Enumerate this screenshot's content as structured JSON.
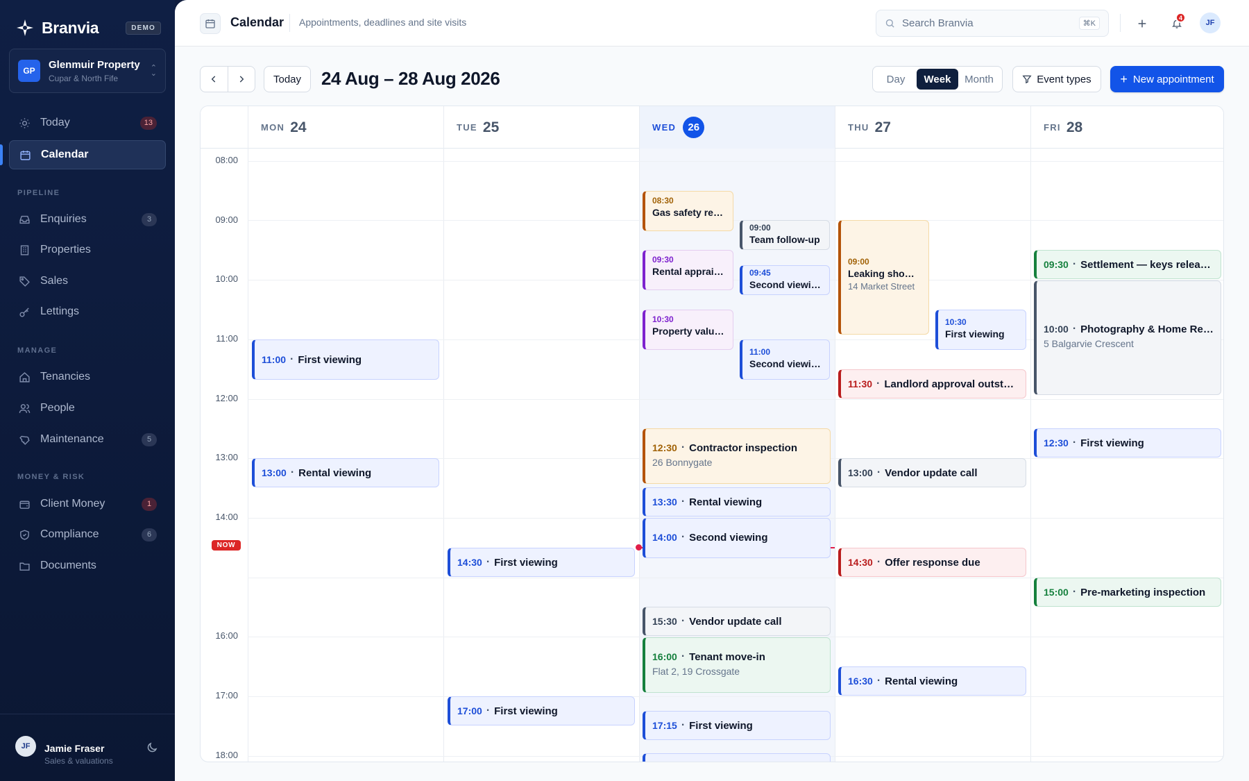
{
  "sidebar": {
    "brand": "Branvia",
    "demo_badge": "DEMO",
    "org": {
      "initials": "GP",
      "name": "Glenmuir Property",
      "subtitle": "Cupar & North Fife"
    },
    "items": {
      "today": {
        "label": "Today",
        "badge": "13"
      },
      "calendar": {
        "label": "Calendar"
      },
      "enquiries": {
        "label": "Enquiries",
        "badge": "3"
      },
      "properties": {
        "label": "Properties"
      },
      "sales": {
        "label": "Sales"
      },
      "lettings": {
        "label": "Lettings"
      },
      "tenancies": {
        "label": "Tenancies"
      },
      "people": {
        "label": "People"
      },
      "maintenance": {
        "label": "Maintenance",
        "badge": "5"
      },
      "client_money": {
        "label": "Client Money",
        "badge": "1"
      },
      "compliance": {
        "label": "Compliance",
        "badge": "6"
      },
      "documents": {
        "label": "Documents"
      }
    },
    "sections": {
      "pipeline": "PIPELINE",
      "manage": "MANAGE",
      "money": "MONEY & RISK"
    },
    "user": {
      "initials": "JF",
      "name": "Jamie Fraser",
      "role": "Sales & valuations"
    }
  },
  "header": {
    "title": "Calendar",
    "subtitle": "Appointments, deadlines and site visits",
    "search_placeholder": "Search Branvia",
    "shortcut": "⌘K",
    "notifications": "4",
    "avatar": "JF"
  },
  "toolbar": {
    "today": "Today",
    "range": "24 Aug – 28 Aug 2026",
    "views": {
      "day": "Day",
      "week": "Week",
      "month": "Month"
    },
    "active_view": "Week",
    "event_types": "Event types",
    "new_appointment": "New appointment"
  },
  "calendar": {
    "days": [
      {
        "dow": "MON",
        "num": "24"
      },
      {
        "dow": "TUE",
        "num": "25"
      },
      {
        "dow": "WED",
        "num": "26"
      },
      {
        "dow": "THU",
        "num": "27"
      },
      {
        "dow": "FRI",
        "num": "28"
      }
    ],
    "hours": [
      "08:00",
      "09:00",
      "10:00",
      "11:00",
      "12:00",
      "13:00",
      "14:00",
      "16:00",
      "17:00",
      "18:00"
    ],
    "now_label": "NOW",
    "colors": {
      "today_accent": "#1254e8",
      "now_line": "#e11d48"
    },
    "events": {
      "mon_1100": {
        "time": "11:00",
        "name": "First viewing"
      },
      "mon_1300": {
        "time": "13:00",
        "name": "Rental viewing"
      },
      "tue_1430": {
        "time": "14:30",
        "name": "First viewing"
      },
      "tue_1700": {
        "time": "17:00",
        "name": "First viewing"
      },
      "wed_0830": {
        "time": "08:30",
        "name": "Gas safety rene…"
      },
      "wed_0900": {
        "time": "09:00",
        "name": "Team follow-up"
      },
      "wed_0930": {
        "time": "09:30",
        "name": "Rental appraisal"
      },
      "wed_0945": {
        "time": "09:45",
        "name": "Second viewing"
      },
      "wed_1030": {
        "time": "10:30",
        "name": "Property valuat…"
      },
      "wed_1100": {
        "time": "11:00",
        "name": "Second viewing"
      },
      "wed_1230": {
        "time": "12:30",
        "name": "Contractor inspection",
        "address": "26 Bonnygate"
      },
      "wed_1330": {
        "time": "13:30",
        "name": "Rental viewing"
      },
      "wed_1400": {
        "time": "14:00",
        "name": "Second viewing"
      },
      "wed_1530": {
        "time": "15:30",
        "name": "Vendor update call"
      },
      "wed_1600": {
        "time": "16:00",
        "name": "Tenant move-in",
        "address": "Flat 2, 19 Crossgate"
      },
      "wed_1715": {
        "time": "17:15",
        "name": "First viewing"
      },
      "thu_0900": {
        "time": "09:00",
        "name": "Leaking showe…",
        "address": "14 Market Street"
      },
      "thu_1030": {
        "time": "10:30",
        "name": "First viewing"
      },
      "thu_1130": {
        "time": "11:30",
        "name": "Landlord approval outstand…"
      },
      "thu_1300": {
        "time": "13:00",
        "name": "Vendor update call"
      },
      "thu_1430": {
        "time": "14:30",
        "name": "Offer response due"
      },
      "thu_1630": {
        "time": "16:30",
        "name": "Rental viewing"
      },
      "fri_0930": {
        "time": "09:30",
        "name": "Settlement — keys released"
      },
      "fri_1000": {
        "time": "10:00",
        "name": "Photography & Home Report",
        "address": "5 Balgarvie Crescent"
      },
      "fri_1230": {
        "time": "12:30",
        "name": "First viewing"
      },
      "fri_1500": {
        "time": "15:00",
        "name": "Pre-marketing inspection"
      }
    }
  }
}
